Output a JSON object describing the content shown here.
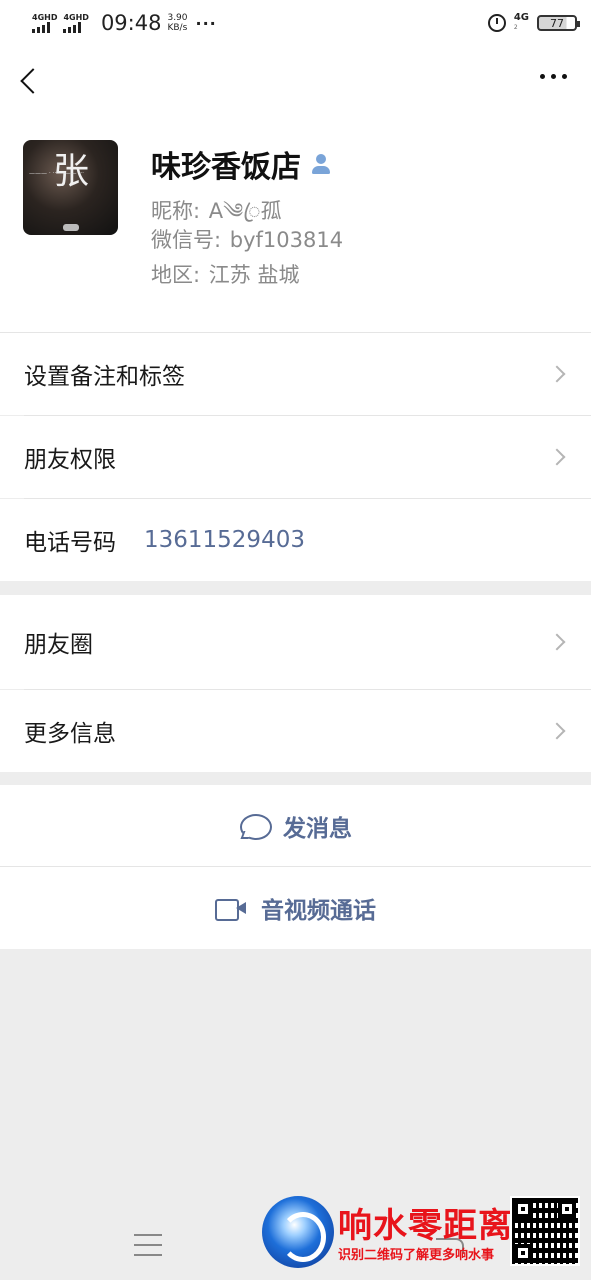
{
  "status_bar": {
    "sim1": "4GHD",
    "sim2": "4GHD",
    "time": "09:48",
    "speed_value": "3.90",
    "speed_unit": "KB/s",
    "more_dots": "···",
    "network": "4G",
    "network_sub": "2",
    "battery": "77"
  },
  "profile": {
    "name": "味珍香饭店",
    "nickname_label": "昵称:",
    "nickname": "A༄ꦿ孤",
    "wechat_id_label": "微信号:",
    "wechat_id": "byf103814",
    "region_label": "地区:",
    "region": "江苏  盐城",
    "avatar_text": "张"
  },
  "menu": {
    "remark_tags": "设置备注和标签",
    "friend_permissions": "朋友权限",
    "phone_label": "电话号码",
    "phone_value": "13611529403",
    "moments": "朋友圈",
    "more_info": "更多信息"
  },
  "actions": {
    "send_message": "发消息",
    "av_call": "音视频通话"
  },
  "watermark": {
    "title": "响水零距离",
    "subtitle": "识别二维码了解更多响水事"
  },
  "colors": {
    "link": "#576b95",
    "background": "#ededed",
    "watermark_red": "#e8141b"
  }
}
